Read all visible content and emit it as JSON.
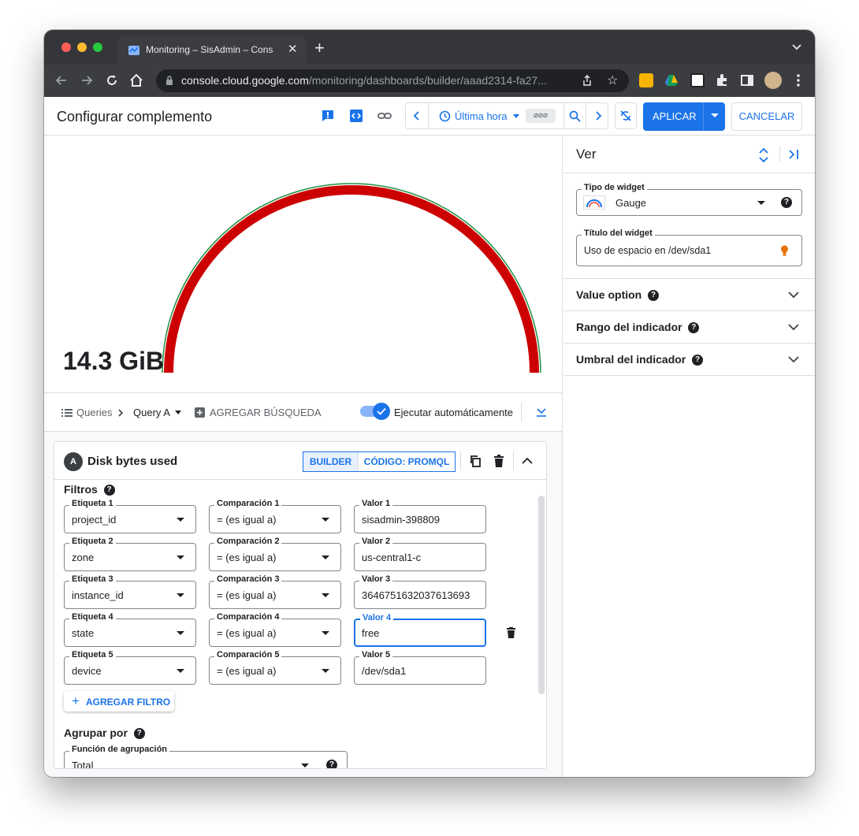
{
  "browser": {
    "tab_title": "Monitoring – SisAdmin – Cons",
    "url_host": "console.cloud.google.com",
    "url_path": "/monitoring/dashboards/builder/aaad2314-fa27..."
  },
  "header": {
    "title": "Configurar complemento",
    "time_range": "Última hora",
    "time_chip": "⌀⌀⌀",
    "apply_label": "APLICAR",
    "cancel_label": "CANCELAR"
  },
  "chart": {
    "value_label": "14.3 GiB",
    "colors": {
      "arc": "#cc0000",
      "outline": "#1e8e3e"
    }
  },
  "query_bar": {
    "queries_label": "Queries",
    "query_selected": "Query A",
    "add_query_label": "AGREGAR BÚSQUEDA",
    "autorun_label": "Ejecutar automáticamente",
    "autorun_on": true
  },
  "query_card": {
    "avatar_letter": "A",
    "name": "Disk bytes used",
    "mode_builder": "BUILDER",
    "mode_promql": "CÓDIGO: PROMQL",
    "filters_title": "Filtros",
    "filters": [
      {
        "label_title": "Etiqueta 1",
        "label": "project_id",
        "cmp_title": "Comparación 1",
        "cmp": "= (es igual a)",
        "val_title": "Valor 1",
        "val": "sisadmin-398809"
      },
      {
        "label_title": "Etiqueta 2",
        "label": "zone",
        "cmp_title": "Comparación 2",
        "cmp": "= (es igual a)",
        "val_title": "Valor 2",
        "val": "us-central1-c"
      },
      {
        "label_title": "Etiqueta 3",
        "label": "instance_id",
        "cmp_title": "Comparación 3",
        "cmp": "= (es igual a)",
        "val_title": "Valor 3",
        "val": "3646751632037613693"
      },
      {
        "label_title": "Etiqueta 4",
        "label": "state",
        "cmp_title": "Comparación 4",
        "cmp": "= (es igual a)",
        "val_title": "Valor 4",
        "val": "free"
      },
      {
        "label_title": "Etiqueta 5",
        "label": "device",
        "cmp_title": "Comparación 5",
        "cmp": "= (es igual a)",
        "val_title": "Valor 5",
        "val": "/dev/sda1"
      }
    ],
    "add_filter_label": "AGREGAR FILTRO",
    "group_title": "Agrupar por",
    "group_fn_title": "Función de agrupación",
    "group_fn_value": "Total"
  },
  "right_panel": {
    "title": "Ver",
    "widget_type_title": "Tipo de widget",
    "widget_type": "Gauge",
    "widget_title_title": "Título del widget",
    "widget_title": "Uso de espacio en /dev/sda1",
    "sections": [
      {
        "label": "Value option"
      },
      {
        "label": "Rango del indicador"
      },
      {
        "label": "Umbral del indicador"
      }
    ]
  }
}
